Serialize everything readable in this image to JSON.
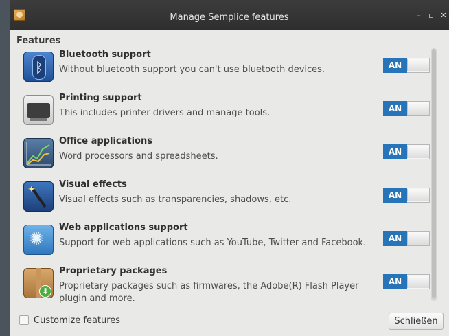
{
  "window": {
    "title": "Manage Semplice features",
    "controls": [
      "–",
      "▫",
      "✕"
    ]
  },
  "section_title": "Features",
  "features": [
    {
      "title": "Bluetooth support",
      "description": "Without bluetooth support you can't use bluetooth devices.",
      "toggle_label": "AN",
      "icon": "bluetooth-icon"
    },
    {
      "title": "Printing support",
      "description": "This includes printer drivers and manage tools.",
      "toggle_label": "AN",
      "icon": "printer-icon"
    },
    {
      "title": "Office applications",
      "description": "Word processors and spreadsheets.",
      "toggle_label": "AN",
      "icon": "chart-icon"
    },
    {
      "title": "Visual effects",
      "description": "Visual effects such as transparencies, shadows, etc.",
      "toggle_label": "AN",
      "icon": "magic-wand-icon"
    },
    {
      "title": "Web applications support",
      "description": "Support for web applications such as YouTube, Twitter and Facebook.",
      "toggle_label": "AN",
      "icon": "web-icon"
    },
    {
      "title": "Proprietary packages",
      "description": "Proprietary packages such as firmwares, the Adobe(R) Flash Player plugin and more.",
      "toggle_label": "AN",
      "icon": "package-icon"
    }
  ],
  "footer": {
    "customize_label": "Customize features",
    "close_label": "Schließen"
  },
  "colors": {
    "toggle_on": "#2874b8",
    "titlebar": "#333333"
  }
}
